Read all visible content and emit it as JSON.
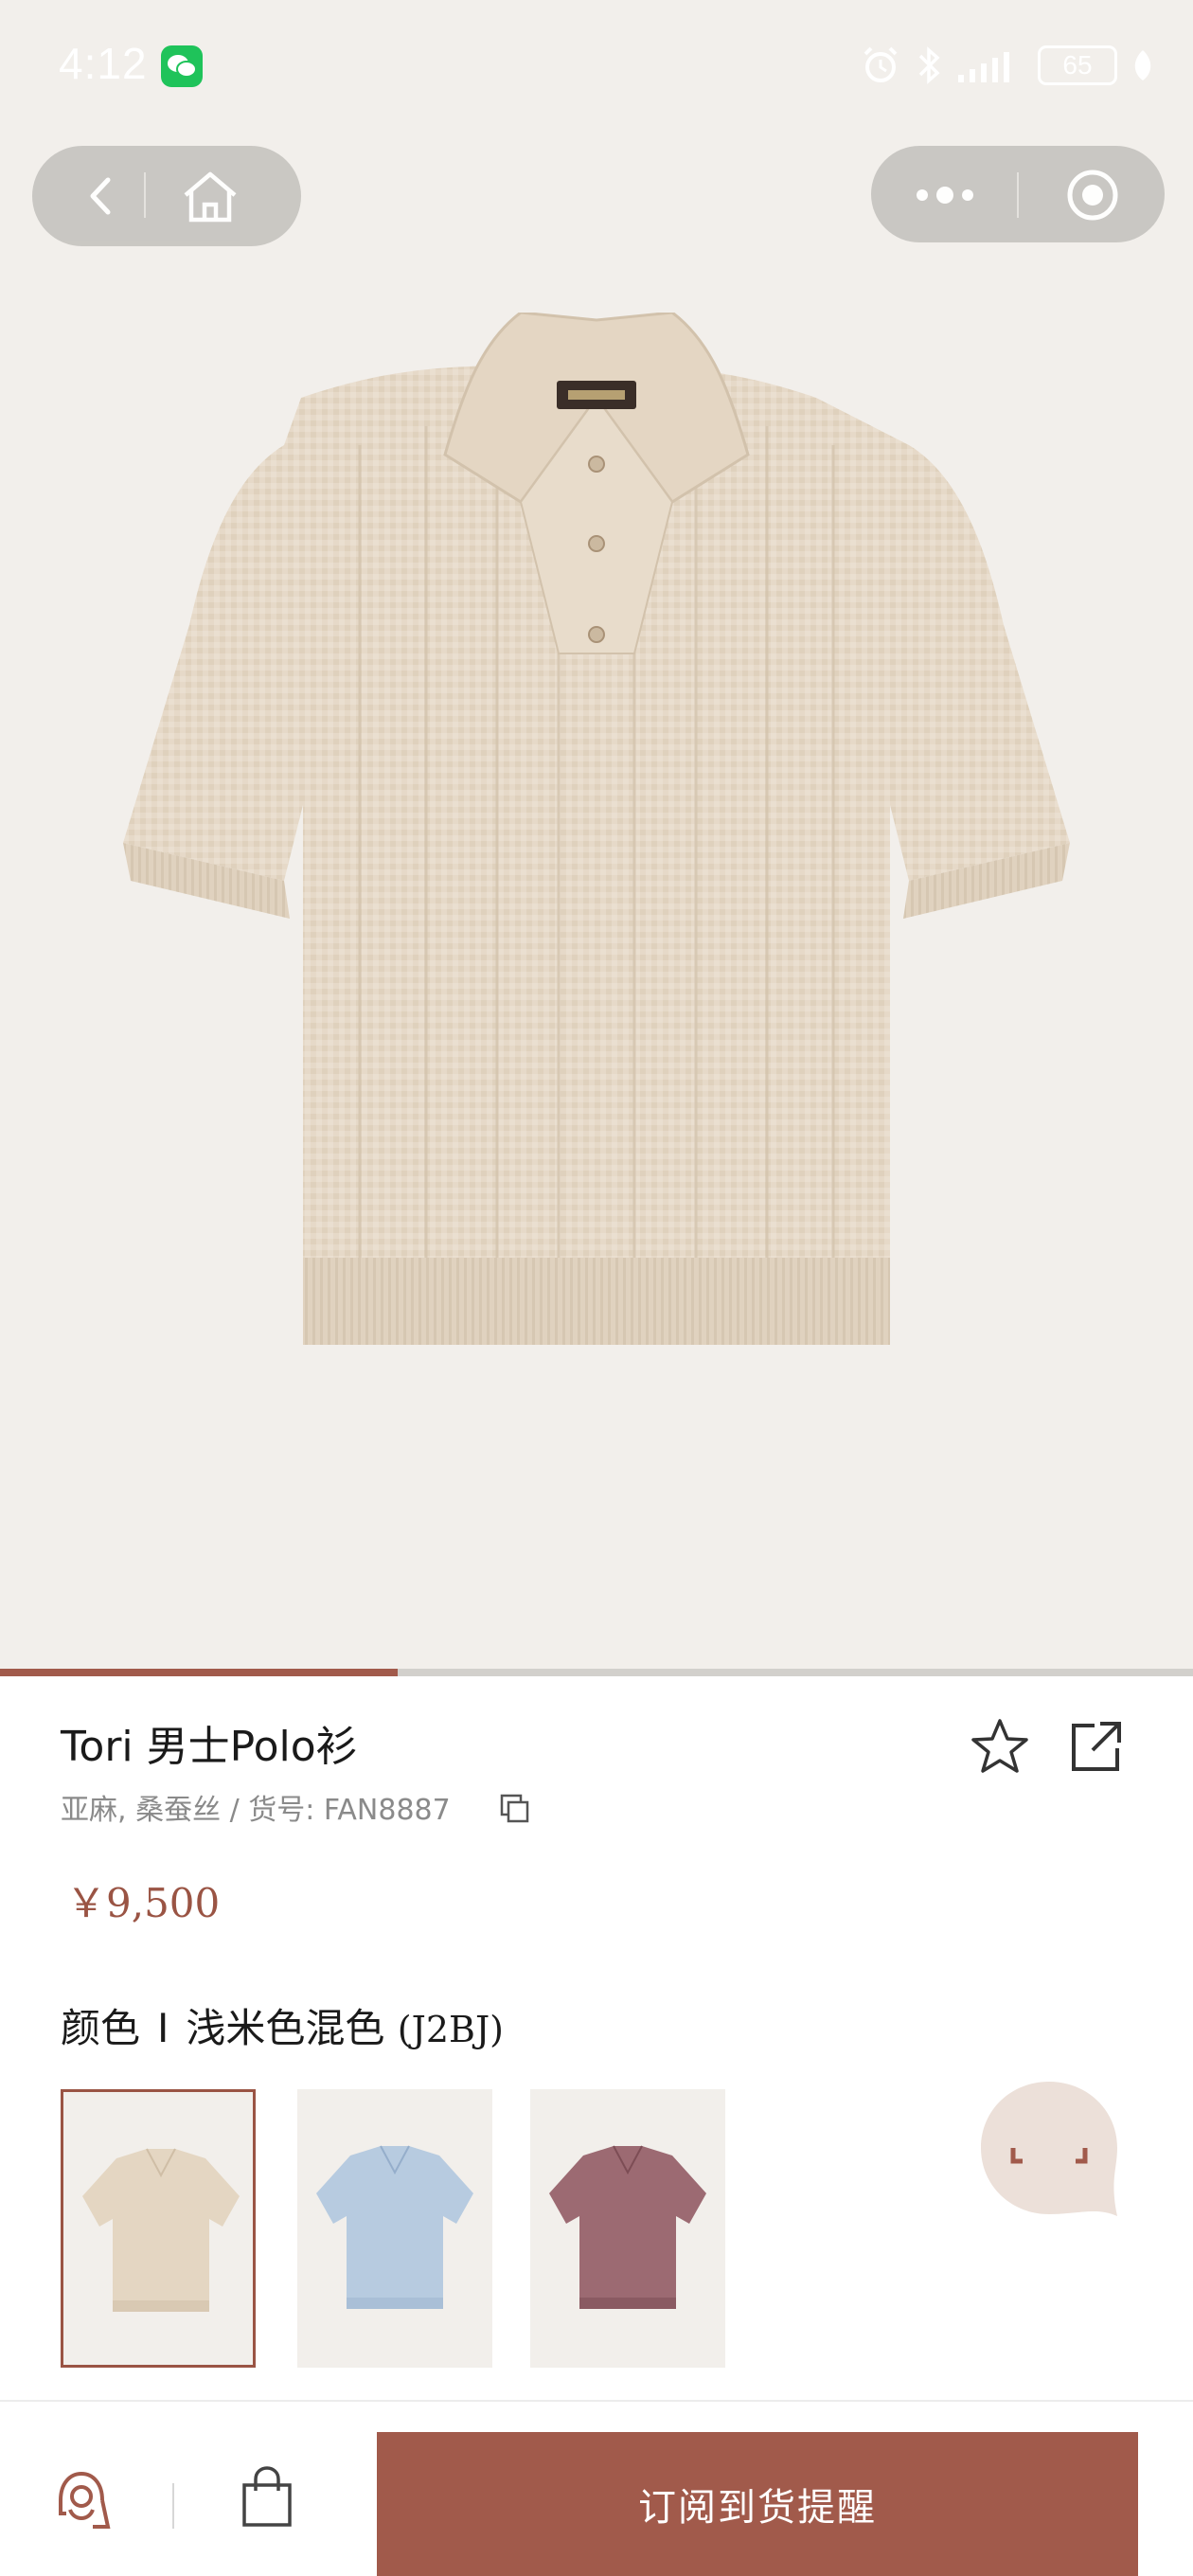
{
  "status_bar": {
    "time": "4:12",
    "battery": "65"
  },
  "nav": {
    "back_icon": "chevron-left-icon",
    "home_icon": "home-icon",
    "more_icon": "more-dots-icon",
    "close_icon": "target-circle-icon"
  },
  "gallery": {
    "current_index": 1,
    "total": 3
  },
  "product": {
    "title": "Tori 男士Polo衫",
    "materials": "亚麻, 桑蚕丝 / 货号:  FAN8887",
    "price": "￥9,500"
  },
  "color": {
    "label": "颜色",
    "separator": "I",
    "name": "浅米色混色",
    "code": "(J2BJ)",
    "swatches": [
      {
        "color": "#e4d6c2"
      },
      {
        "color": "#b7cbe0"
      },
      {
        "color": "#9c6a72"
      }
    ]
  },
  "bottom_bar": {
    "cta_label": "订阅到货提醒"
  },
  "colors": {
    "accent": "#a15a4b",
    "background": "#f2efeb"
  }
}
